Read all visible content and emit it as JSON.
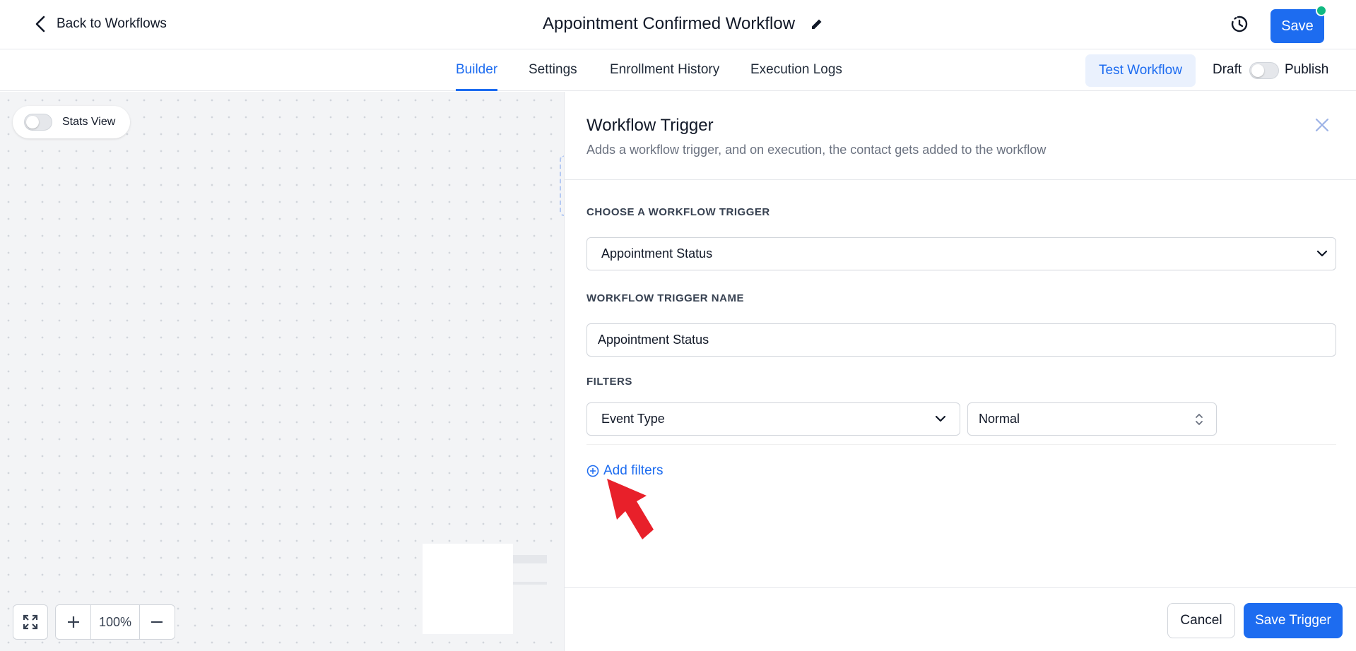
{
  "header": {
    "back_label": "Back to Workflows",
    "title": "Appointment Confirmed Workflow",
    "save_label": "Save",
    "history_icon": "history-clock-icon",
    "edit_icon": "pencil-icon",
    "status_dot_color": "#10b981"
  },
  "tabs": [
    {
      "label": "Builder",
      "active": true
    },
    {
      "label": "Settings",
      "active": false
    },
    {
      "label": "Enrollment History",
      "active": false
    },
    {
      "label": "Execution Logs",
      "active": false
    }
  ],
  "toolbar": {
    "test_label": "Test Workflow",
    "draft_label": "Draft",
    "publish_label": "Publish",
    "publish_on": false
  },
  "canvas": {
    "stats_label": "Stats View",
    "stats_on": false,
    "zoom": "100%"
  },
  "panel": {
    "title": "Workflow Trigger",
    "subtitle": "Adds a workflow trigger, and on execution, the contact gets added to the workflow",
    "trigger_section_label": "CHOOSE A WORKFLOW TRIGGER",
    "trigger_value": "Appointment Status",
    "name_section_label": "WORKFLOW TRIGGER NAME",
    "name_value": "Appointment Status",
    "filters_label": "FILTERS",
    "filter_field": "Event Type",
    "filter_value": "Normal",
    "add_filters_label": "Add filters",
    "cancel_label": "Cancel",
    "save_trigger_label": "Save Trigger"
  },
  "colors": {
    "accent": "#1d6cf0",
    "annotation_arrow": "#e8202a"
  }
}
